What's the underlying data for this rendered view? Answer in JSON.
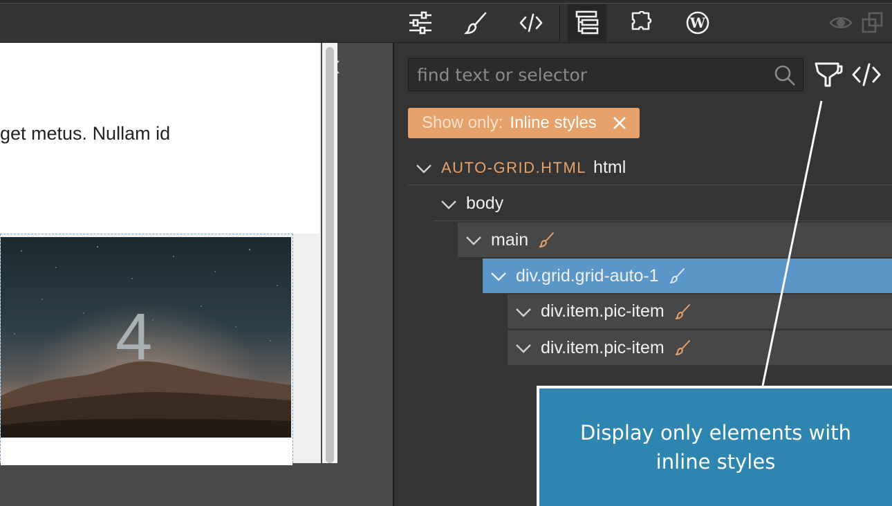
{
  "toolbar": {
    "icons": [
      "settings-sliders-icon",
      "paint-brush-icon",
      "code-icon",
      "tree-icon",
      "puzzle-icon",
      "wordpress-icon",
      "eye-icon",
      "duplicate-window-icon"
    ],
    "active": "tree-icon"
  },
  "preview": {
    "paragraph": "get metus. Nullam id",
    "tile_number": "4"
  },
  "tree_panel": {
    "search": {
      "placeholder": "find text or selector",
      "value": ""
    },
    "filter": {
      "label": "Show only:",
      "value": "Inline styles"
    },
    "nodes": [
      {
        "file": "AUTO-GRID.HTML",
        "label": "html",
        "has_inline_style": false
      },
      {
        "label": "body",
        "has_inline_style": false
      },
      {
        "label": "main",
        "has_inline_style": true
      },
      {
        "label": "div.grid.grid-auto-1",
        "has_inline_style": true,
        "selected": true
      },
      {
        "label": "div.item.pic-item",
        "has_inline_style": true
      },
      {
        "label": "div.item.pic-item",
        "has_inline_style": true
      }
    ]
  },
  "callout": {
    "text": "Display only elements with inline styles"
  },
  "colors": {
    "accent_orange": "#e6a26a",
    "selected_blue": "#5a96c8",
    "callout_blue": "#2e86b0"
  }
}
